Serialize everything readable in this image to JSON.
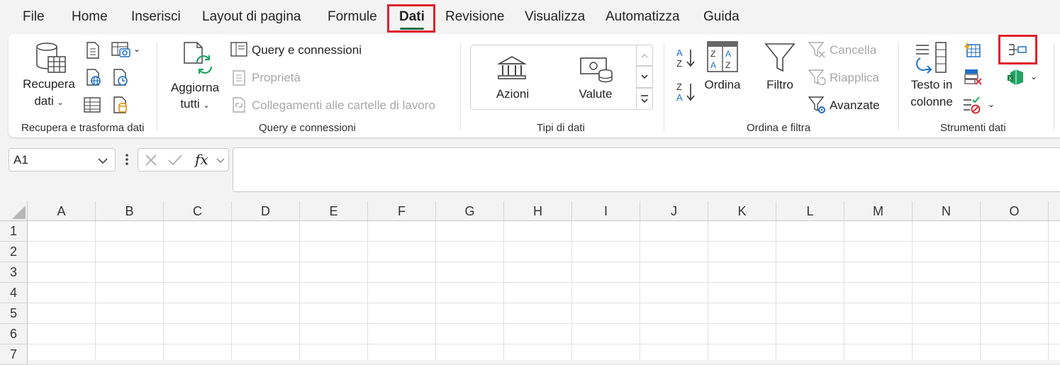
{
  "menu": {
    "tabs": [
      "File",
      "Home",
      "Inserisci",
      "Layout di pagina",
      "Formule",
      "Dati",
      "Revisione",
      "Visualizza",
      "Automatizza",
      "Guida"
    ],
    "active": "Dati"
  },
  "ribbon": {
    "get_transform": {
      "recupera_line1": "Recupera",
      "recupera_line2": "dati",
      "group_label": "Recupera e trasforma dati"
    },
    "queries": {
      "refresh_line1": "Aggiorna",
      "refresh_line2": "tutti",
      "queries_connections": "Query e connessioni",
      "properties": "Proprietà",
      "edit_links": "Collegamenti alle cartelle di lavoro",
      "group_label": "Query e connessioni"
    },
    "data_types": {
      "stocks": "Azioni",
      "currencies": "Valute",
      "group_label": "Tipi di dati"
    },
    "sort_filter": {
      "sort": "Ordina",
      "filter": "Filtro",
      "clear": "Cancella",
      "reapply": "Riapplica",
      "advanced": "Avanzate",
      "group_label": "Ordina e filtra"
    },
    "data_tools": {
      "text_to_columns_line1": "Testo in",
      "text_to_columns_line2": "colonne",
      "group_label": "Strumenti dati"
    }
  },
  "formula_bar": {
    "name_box": "A1",
    "fx": "fx",
    "value": ""
  },
  "sheet": {
    "columns": [
      "A",
      "B",
      "C",
      "D",
      "E",
      "F",
      "G",
      "H",
      "I",
      "J",
      "K",
      "L",
      "M",
      "N",
      "O"
    ],
    "rows": [
      "1",
      "2",
      "3",
      "4",
      "5",
      "6",
      "7"
    ]
  },
  "colors": {
    "accent_green": "#1e7145",
    "highlight_red": "#e0212b",
    "icon_blue": "#1f6fc5"
  }
}
